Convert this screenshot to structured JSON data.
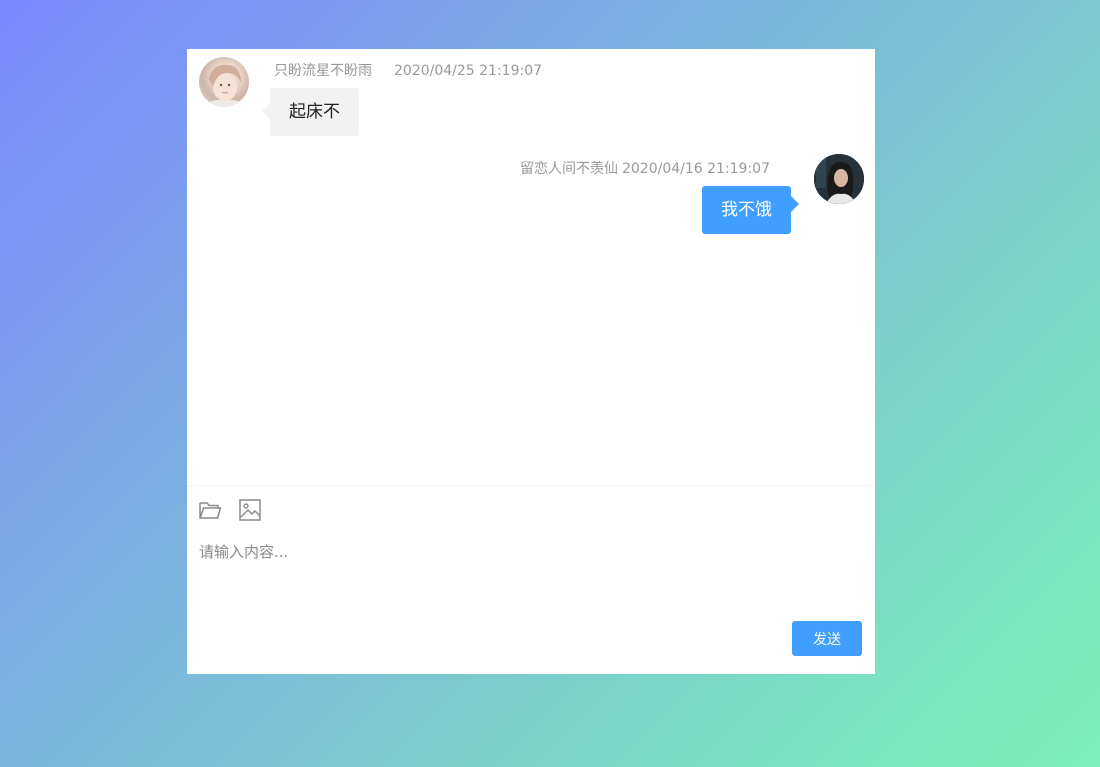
{
  "conversation": {
    "messages": [
      {
        "side": "left",
        "sender": "只盼流星不盼雨",
        "time": "2020/04/25 21:19:07",
        "text": "起床不"
      },
      {
        "side": "right",
        "sender": "留恋人间不羡仙",
        "time": "2020/04/16 21:19:07",
        "text": "我不饿"
      }
    ]
  },
  "composer": {
    "placeholder": "请输入内容...",
    "value": "",
    "send_label": "发送",
    "tools": [
      "folder-icon",
      "image-icon"
    ]
  },
  "colors": {
    "accent": "#409eff",
    "bubble_incoming": "#f2f2f2",
    "meta_text": "#999999"
  }
}
